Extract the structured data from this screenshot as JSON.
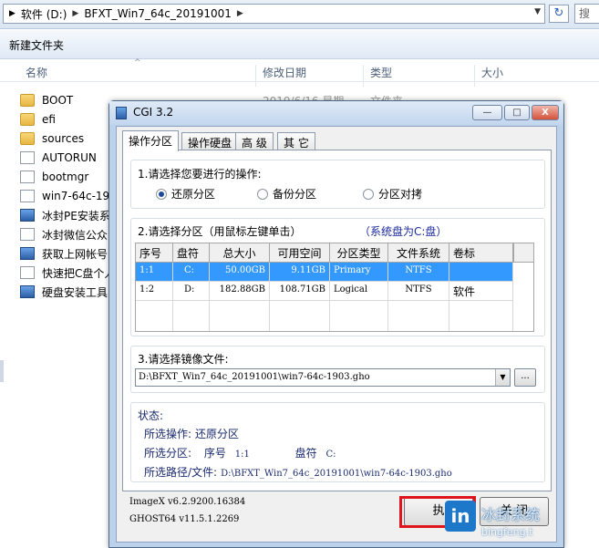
{
  "explorer": {
    "address_parts": [
      "软件 (D:)",
      "BFXT_Win7_64c_20191001"
    ],
    "search_placeholder": "搜",
    "toolbar_new_folder": "新建文件夹",
    "columns": [
      "名称",
      "修改日期",
      "类型",
      "大小"
    ],
    "files": [
      {
        "name": "BOOT",
        "icon": "folder-icon"
      },
      {
        "name": "efi",
        "icon": "folder-icon"
      },
      {
        "name": "sources",
        "icon": "folder-icon"
      },
      {
        "name": "AUTORUN",
        "icon": "autorun-icon"
      },
      {
        "name": "bootmgr",
        "icon": "file-icon"
      },
      {
        "name": "win7-64c-19",
        "icon": "gho-file-icon"
      },
      {
        "name": "冰封PE安装系",
        "icon": "app-icon"
      },
      {
        "name": "冰封微信公众",
        "icon": "image-file-icon"
      },
      {
        "name": "获取上网帐号",
        "icon": "app-icon"
      },
      {
        "name": "快速把C盘个人",
        "icon": "shortcut-icon"
      },
      {
        "name": "硬盘安装工具",
        "icon": "app-icon"
      }
    ],
    "partial_date": "2019/6/16 星期",
    "partial_type": "文件夹"
  },
  "window": {
    "title": "CGI 3.2",
    "tabs": [
      "操作分区",
      "操作硬盘",
      "高 级",
      "其 它"
    ],
    "active_tab": 0,
    "section1": {
      "label": "1.请选择您要进行的操作:",
      "options": [
        "还原分区",
        "备份分区",
        "分区对拷"
      ],
      "selected": 0
    },
    "section2": {
      "label": "2.请选择分区（用鼠标左键单击）",
      "system_disk_note": "（系统盘为C:盘）",
      "headers": [
        "序号",
        "盘符",
        "总大小",
        "可用空间",
        "分区类型",
        "文件系统",
        "卷标"
      ],
      "rows": [
        [
          "1:1",
          "C:",
          "50.00GB",
          "9.11GB",
          "Primary",
          "NTFS",
          ""
        ],
        [
          "1:2",
          "D:",
          "182.88GB",
          "108.71GB",
          "Logical",
          "NTFS",
          "软件"
        ]
      ],
      "selected_row": 0
    },
    "section3": {
      "label": "3.请选择镜像文件:",
      "image_path": "D:\\BFXT_Win7_64c_20191001\\win7-64c-1903.gho",
      "browse_label": "..."
    },
    "status": {
      "label": "状态:",
      "op_label": "所选操作:",
      "op_value": "还原分区",
      "part_label": "所选分区:",
      "part_no_label": "序号",
      "part_no": "1:1",
      "drive_label": "盘符",
      "drive": "C:",
      "path_label": "所选路径/文件:",
      "path": "D:\\BFXT_Win7_64c_20191001\\win7-64c-1903.gho"
    },
    "versions": [
      "ImageX v6.2.9200.16384",
      "GHOST64 v11.5.1.2269"
    ],
    "execute_label": "执",
    "close_label": "关 闭",
    "titlebar_buttons": [
      "—",
      "□",
      "X"
    ]
  },
  "watermark": {
    "logo": "in",
    "text": "冰封系统",
    "url": "bingfeng.t"
  },
  "colors": {
    "selection": "#3399ff",
    "highlight_box": "#e0141b",
    "note_blue": "#1a2a9e"
  }
}
